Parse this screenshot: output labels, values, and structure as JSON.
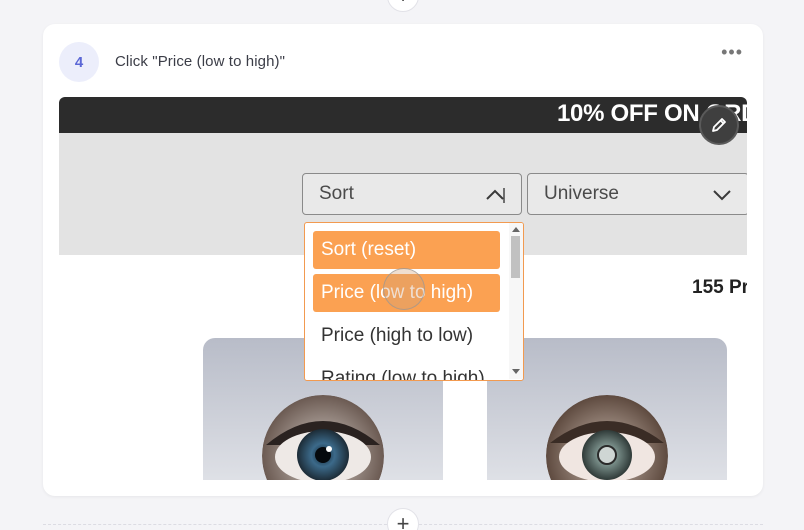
{
  "step": {
    "number": "4",
    "title": "Click \"Price (low to high)\"",
    "more_label": "•••"
  },
  "add_step_label": "+",
  "screenshot": {
    "promo_text": "10% OFF ON ORD",
    "sort_select": {
      "value": "Sort",
      "icon": "chevron-up-icon"
    },
    "universe_select": {
      "value": "Universe",
      "icon": "chevron-down-icon"
    },
    "dropdown_options": [
      {
        "label": "Sort (reset)",
        "highlighted": true
      },
      {
        "label": "Price (low to high)",
        "highlighted": true
      },
      {
        "label": "Price (high to low)",
        "highlighted": false
      },
      {
        "label": "Rating (low to high)",
        "highlighted": false
      }
    ],
    "product_count": "155 Pr",
    "edit_icon": "pencil-icon"
  },
  "colors": {
    "accent": "#fba152",
    "badge_bg": "#eceefb",
    "badge_text": "#5b67d6",
    "promo_bar": "#2c2c2c"
  }
}
